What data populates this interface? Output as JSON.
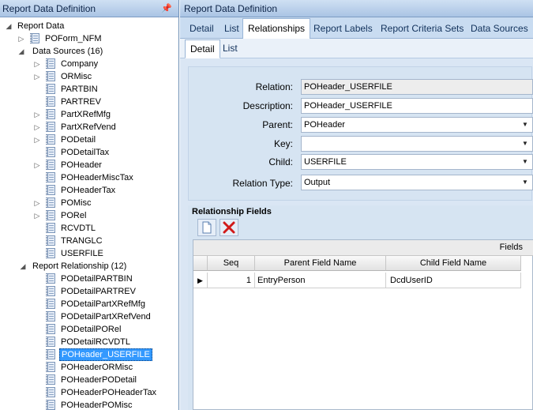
{
  "left_pane": {
    "title": "Report Data Definition",
    "pin_icon": "pin-icon",
    "tree": {
      "root": "Report Data",
      "report": "POForm_NFM",
      "data_sources": {
        "label": "Data Sources (16)",
        "items": [
          "Company",
          "ORMisc",
          "PARTBIN",
          "PARTREV",
          "PartXRefMfg",
          "PartXRefVend",
          "PODetail",
          "PODetailTax",
          "POHeader",
          "POHeaderMiscTax",
          "POHeaderTax",
          "POMisc",
          "PORel",
          "RCVDTL",
          "TRANGLC",
          "USERFILE"
        ]
      },
      "relationships": {
        "label": "Report Relationship (12)",
        "items": [
          "PODetailPARTBIN",
          "PODetailPARTREV",
          "PODetailPartXRefMfg",
          "PODetailPartXRefVend",
          "PODetailPORel",
          "PODetailRCVDTL",
          "POHeader_USERFILE",
          "POHeaderORMisc",
          "POHeaderPODetail",
          "POHeaderPOHeaderTax",
          "POHeaderPOMisc"
        ],
        "selected": "POHeader_USERFILE"
      }
    }
  },
  "right_pane": {
    "title": "Report Data Definition",
    "main_tabs": [
      "Detail",
      "List",
      "Relationships",
      "Report Labels",
      "Report Criteria Sets",
      "Data Sources"
    ],
    "active_main_tab": "Relationships",
    "sub_tabs": [
      "Detail",
      "List"
    ],
    "active_sub_tab": "Detail",
    "form": {
      "relation_label": "Relation:",
      "relation_value": "POHeader_USERFILE",
      "description_label": "Description:",
      "description_value": "POHeader_USERFILE",
      "parent_label": "Parent:",
      "parent_value": "POHeader",
      "key_label": "Key:",
      "key_value": "",
      "child_label": "Child:",
      "child_value": "USERFILE",
      "relation_type_label": "Relation Type:",
      "relation_type_value": "Output"
    },
    "relationship_fields": {
      "title": "Relationship Fields",
      "band_label": "Fields",
      "columns": [
        "Seq",
        "Parent Field Name",
        "Child Field Name"
      ],
      "rows": [
        {
          "seq": "1",
          "parent": "EntryPerson",
          "child": "DcdUserID"
        }
      ]
    }
  },
  "colors": {
    "selection": "#3399ff",
    "pane_header": "#aac4e4",
    "panel_bg": "#d6e4f2",
    "delete_red": "#d11a1a"
  }
}
